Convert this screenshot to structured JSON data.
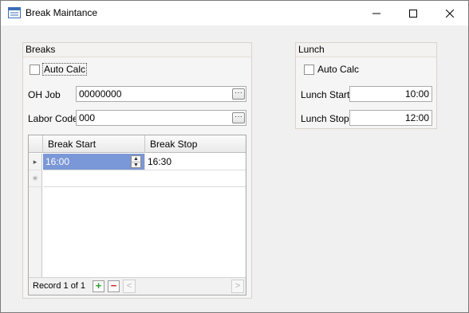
{
  "window": {
    "title": "Break Maintance",
    "icon": "form-icon",
    "controls": {
      "minimize": "–",
      "maximize": "☐",
      "close": "✕"
    }
  },
  "breaks": {
    "header": "Breaks",
    "auto_calc_label": "Auto Calc",
    "auto_calc_checked": false,
    "oh_job_label": "OH Job",
    "oh_job_value": "00000000",
    "labor_code_label": "Labor Code",
    "labor_code_value": "000",
    "ellipsis": "···",
    "grid": {
      "columns": [
        "Break Start",
        "Break Stop"
      ],
      "rows": [
        {
          "start": "16:00",
          "stop": "16:30"
        }
      ],
      "new_row_marker": "✳",
      "current_row_marker": "▸",
      "record_text": "Record 1 of 1",
      "add_symbol": "+",
      "remove_symbol": "−",
      "scroll_left": "<",
      "scroll_right": ">"
    }
  },
  "lunch": {
    "header": "Lunch",
    "auto_calc_label": "Auto Calc",
    "auto_calc_checked": false,
    "lunch_start_label": "Lunch Start",
    "lunch_start_value": "10:00",
    "lunch_stop_label": "Lunch Stop",
    "lunch_stop_value": "12:00"
  },
  "colors": {
    "selected_cell": "#7a97d7",
    "add_green": "#2e9e2e",
    "remove_red": "#d22222"
  }
}
